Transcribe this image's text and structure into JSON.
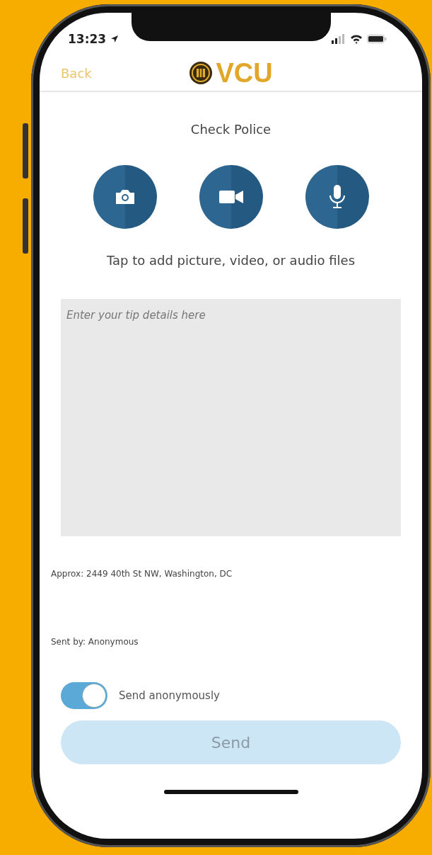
{
  "status_bar": {
    "time": "13:23"
  },
  "nav": {
    "back": "Back",
    "logo": "VCU"
  },
  "title": "Check Police",
  "media_buttons": [
    {
      "kind": "camera"
    },
    {
      "kind": "video"
    },
    {
      "kind": "microphone"
    }
  ],
  "media_hint": "Tap to add picture, video, or audio files",
  "tip_field": {
    "placeholder": "Enter your tip details here"
  },
  "location": "Approx: 2449 40th St NW, Washington, DC",
  "sent_by": "Sent by: Anonymous",
  "anonymous_toggle": {
    "label": "Send anonymously",
    "on": true
  },
  "send_button": {
    "label": "Send",
    "disabled": true
  }
}
